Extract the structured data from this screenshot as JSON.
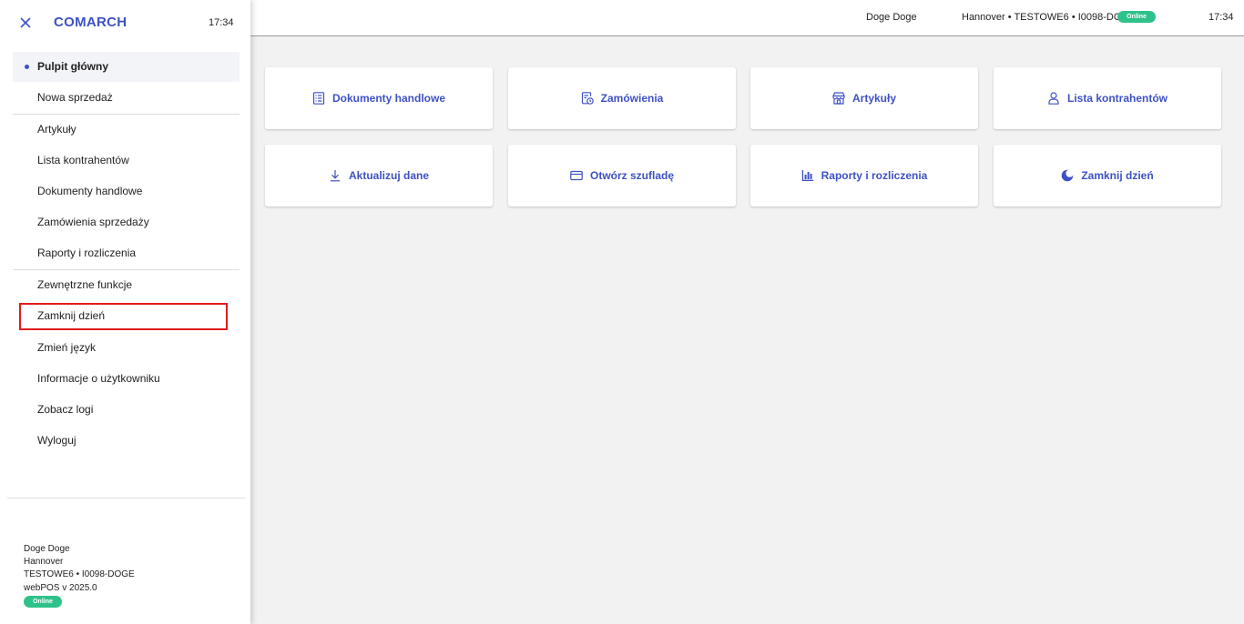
{
  "topbar": {
    "user": "Doge Doge",
    "store": "Hannover • TESTOWE6 • I0098-DOGE",
    "status": "Online",
    "time": "17:34"
  },
  "tiles": [
    {
      "label": "Dokumenty handlowe",
      "icon": "document-list-icon"
    },
    {
      "label": "Zamówienia",
      "icon": "order-clock-icon"
    },
    {
      "label": "Artykuły",
      "icon": "store-icon"
    },
    {
      "label": "Lista kontrahentów",
      "icon": "person-icon"
    },
    {
      "label": "Aktualizuj dane",
      "icon": "download-icon"
    },
    {
      "label": "Otwórz szufladę",
      "icon": "card-icon"
    },
    {
      "label": "Raporty i rozliczenia",
      "icon": "bar-chart-icon"
    },
    {
      "label": "Zamknij dzień",
      "icon": "moon-icon"
    }
  ],
  "sidebar": {
    "brand": "COMARCH",
    "time": "17:34",
    "items": [
      {
        "label": "Pulpit główny",
        "active": true
      },
      {
        "label": "Nowa sprzedaż"
      },
      {
        "label": "Artykuły"
      },
      {
        "label": "Lista kontrahentów"
      },
      {
        "label": "Dokumenty handlowe"
      },
      {
        "label": "Zamówienia sprzedaży"
      },
      {
        "label": "Raporty i rozliczenia"
      },
      {
        "label": "Zewnętrzne funkcje"
      },
      {
        "label": "Zamknij dzień",
        "highlighted": true
      },
      {
        "label": "Zmień język"
      },
      {
        "label": "Informacje o użytkowniku"
      },
      {
        "label": "Zobacz logi"
      },
      {
        "label": "Wyloguj"
      }
    ],
    "footer": {
      "user": "Doge Doge",
      "store": "Hannover",
      "terminal": "TESTOWE6 • I0098-DOGE",
      "version": "webPOS v 2025.0",
      "status": "Online"
    }
  },
  "colors": {
    "accent": "#3e51c4",
    "online": "#2ec28a",
    "highlight": "#e11b1b"
  }
}
